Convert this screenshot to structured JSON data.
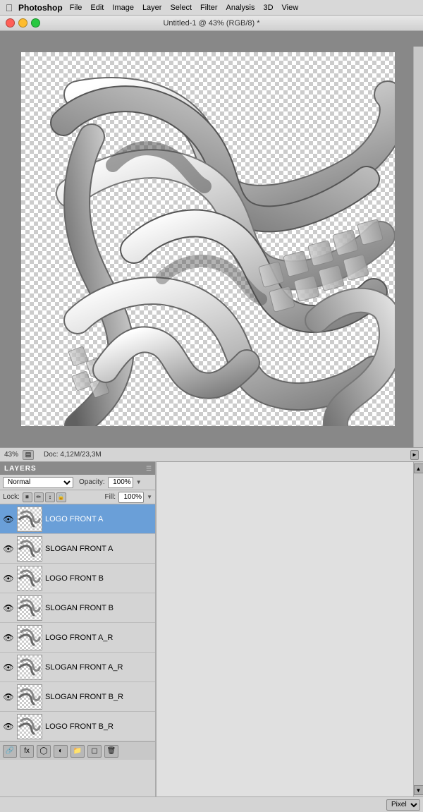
{
  "menubar": {
    "appname": "Photoshop",
    "menus": [
      "File",
      "Edit",
      "Image",
      "Layer",
      "Select",
      "Filter",
      "Analysis",
      "3D",
      "View"
    ]
  },
  "titlebar": {
    "title": "Untitled-1 @ 43% (RGB/8) *"
  },
  "statusbar": {
    "zoom": "43%",
    "docinfo": "Doc: 4,12M/23,3M"
  },
  "layers_panel": {
    "title": "LAYERS",
    "blend_mode": "Normal",
    "opacity_label": "Opacity:",
    "opacity_value": "100%",
    "lock_label": "Lock:",
    "fill_label": "Fill:",
    "fill_value": "100%",
    "layers": [
      {
        "name": "LOGO FRONT A",
        "visible": true,
        "selected": true
      },
      {
        "name": "SLOGAN FRONT A",
        "visible": true,
        "selected": false
      },
      {
        "name": "LOGO FRONT B",
        "visible": true,
        "selected": false
      },
      {
        "name": "SLOGAN FRONT B",
        "visible": true,
        "selected": false
      },
      {
        "name": "LOGO FRONT A_R",
        "visible": true,
        "selected": false
      },
      {
        "name": "SLOGAN FRONT A_R",
        "visible": true,
        "selected": false
      },
      {
        "name": "SLOGAN FRONT B_R",
        "visible": true,
        "selected": false
      },
      {
        "name": "LOGO FRONT B_R",
        "visible": true,
        "selected": false
      }
    ]
  },
  "bottom_strip": {
    "pixel_label": "Pixel"
  }
}
